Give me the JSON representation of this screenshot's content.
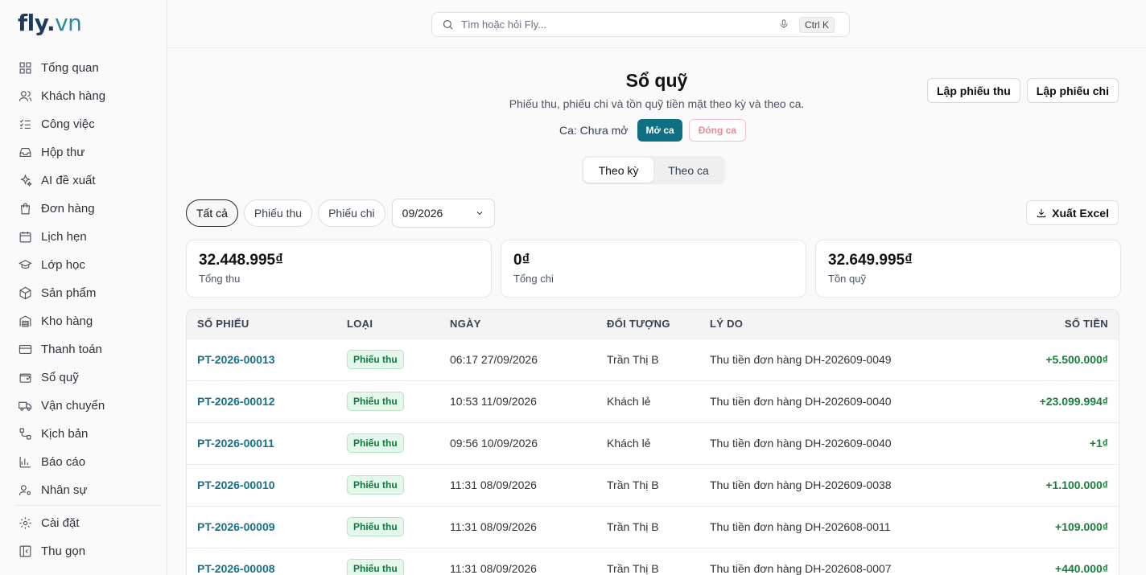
{
  "brand": {
    "name": "fly",
    "dot": ".",
    "tld": "vn"
  },
  "search": {
    "placeholder": "Tìm hoặc hỏi Fly...",
    "shortcut": "Ctrl K"
  },
  "sidebar": {
    "items": [
      {
        "label": "Tổng quan",
        "icon": "grid-icon"
      },
      {
        "label": "Khách hàng",
        "icon": "users-icon"
      },
      {
        "label": "Công việc",
        "icon": "tasks-icon"
      },
      {
        "label": "Hộp thư",
        "icon": "inbox-icon"
      },
      {
        "label": "AI đề xuất",
        "icon": "sparkles-icon"
      },
      {
        "label": "Đơn hàng",
        "icon": "shopping-bag-icon"
      },
      {
        "label": "Lịch hẹn",
        "icon": "calendar-icon"
      },
      {
        "label": "Lớp học",
        "icon": "graduation-cap-icon"
      },
      {
        "label": "Sản phẩm",
        "icon": "package-icon"
      },
      {
        "label": "Kho hàng",
        "icon": "warehouse-icon"
      },
      {
        "label": "Thanh toán",
        "icon": "credit-card-icon"
      },
      {
        "label": "Sổ quỹ",
        "icon": "wallet-icon"
      },
      {
        "label": "Vận chuyển",
        "icon": "truck-icon"
      },
      {
        "label": "Kịch bản",
        "icon": "workflow-icon"
      },
      {
        "label": "Báo cáo",
        "icon": "bar-chart-icon"
      },
      {
        "label": "Nhân sự",
        "icon": "user-cog-icon"
      }
    ],
    "bottom": [
      {
        "label": "Cài đặt",
        "icon": "gear-icon"
      },
      {
        "label": "Thu gọn",
        "icon": "collapse-panel-icon"
      }
    ]
  },
  "header": {
    "title": "Sổ quỹ",
    "subtitle": "Phiếu thu, phiếu chi và tồn quỹ tiền mặt theo kỳ và theo ca.",
    "shift_label": "Ca: Chưa mở",
    "open_shift": "Mở ca",
    "close_shift": "Đóng ca",
    "create_receipt": "Lập phiếu thu",
    "create_payment": "Lập phiếu chi"
  },
  "view_tabs": [
    {
      "label": "Theo kỳ",
      "active": true
    },
    {
      "label": "Theo ca",
      "active": false
    }
  ],
  "filters": {
    "chips": [
      {
        "label": "Tất cả",
        "active": true
      },
      {
        "label": "Phiếu thu",
        "active": false
      },
      {
        "label": "Phiếu chi",
        "active": false
      }
    ],
    "period": "09/2026",
    "export_label": "Xuất Excel"
  },
  "summary": [
    {
      "amount": "32.448.995₫",
      "label": "Tổng thu"
    },
    {
      "amount": "0₫",
      "label": "Tổng chi"
    },
    {
      "amount": "32.649.995₫",
      "label": "Tồn quỹ"
    }
  ],
  "table": {
    "headers": [
      "SỐ PHIẾU",
      "LOẠI",
      "NGÀY",
      "ĐỐI TƯỢNG",
      "LÝ DO",
      "SỐ TIỀN"
    ],
    "rows": [
      {
        "no": "PT-2026-00013",
        "type": "Phiếu thu",
        "date": "06:17 27/09/2026",
        "party": "Trần Thị B",
        "reason": "Thu tiền đơn hàng DH-202609-0049",
        "amount": "+5.500.000₫"
      },
      {
        "no": "PT-2026-00012",
        "type": "Phiếu thu",
        "date": "10:53 11/09/2026",
        "party": "Khách lẻ",
        "reason": "Thu tiền đơn hàng DH-202609-0040",
        "amount": "+23.099.994₫"
      },
      {
        "no": "PT-2026-00011",
        "type": "Phiếu thu",
        "date": "09:56 10/09/2026",
        "party": "Khách lẻ",
        "reason": "Thu tiền đơn hàng DH-202609-0040",
        "amount": "+1₫"
      },
      {
        "no": "PT-2026-00010",
        "type": "Phiếu thu",
        "date": "11:31 08/09/2026",
        "party": "Trần Thị B",
        "reason": "Thu tiền đơn hàng DH-202609-0038",
        "amount": "+1.100.000₫"
      },
      {
        "no": "PT-2026-00009",
        "type": "Phiếu thu",
        "date": "11:31 08/09/2026",
        "party": "Trần Thị B",
        "reason": "Thu tiền đơn hàng DH-202608-0011",
        "amount": "+109.000₫"
      },
      {
        "no": "PT-2026-00008",
        "type": "Phiếu thu",
        "date": "11:31 08/09/2026",
        "party": "Trần Thị B",
        "reason": "Thu tiền đơn hàng DH-202608-0007",
        "amount": "+440.000₫"
      }
    ]
  },
  "colors": {
    "accent": "#0f7083",
    "link": "#16708a",
    "positive": "#1b7e3a",
    "danger_soft": "#e58a96"
  }
}
